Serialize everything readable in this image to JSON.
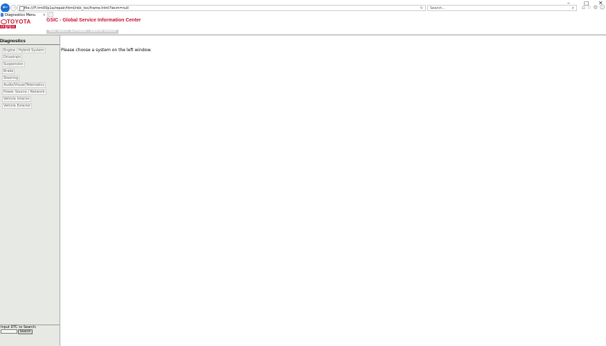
{
  "browser": {
    "window_controls": [
      "–",
      "□",
      "✕"
    ],
    "address": "file:///F:/rm00p1a/repair/html/nkk_toc/frame.html?lecm=null",
    "refresh_symbol": "↻",
    "search_placeholder": "Search...",
    "search_icon_symbol": "⌕",
    "tab_title": "Diagnostics Menu",
    "tab_close": "×",
    "toolbar_icons": "⌂☆⚙☺"
  },
  "header": {
    "brand": "TOYOTA",
    "flags": [
      "EN",
      "JP",
      "DE"
    ],
    "title": "GSIC - Global Service Information Center",
    "vehicle": "Your select: ALPHARD / AWH30 GGH30"
  },
  "sidebar": {
    "heading": "Diagnostics",
    "items": [
      "Engine / Hybrid System",
      "Drivetrain",
      "Suspension",
      "Brake",
      "Steering",
      "Audio/Visual/Telematics",
      "Power Source / Network",
      "Vehicle Interior",
      "Vehicle Exterior"
    ],
    "dtc_label": "Input DTC to Search:",
    "dtc_value": "",
    "dtc_button": "Search"
  },
  "main": {
    "message": "Please choose a system on the left window."
  },
  "colors": {
    "brand_red": "#c8102e",
    "sidebar_bg": "#e7e9e4",
    "browser_blue": "#1b6fd1"
  }
}
